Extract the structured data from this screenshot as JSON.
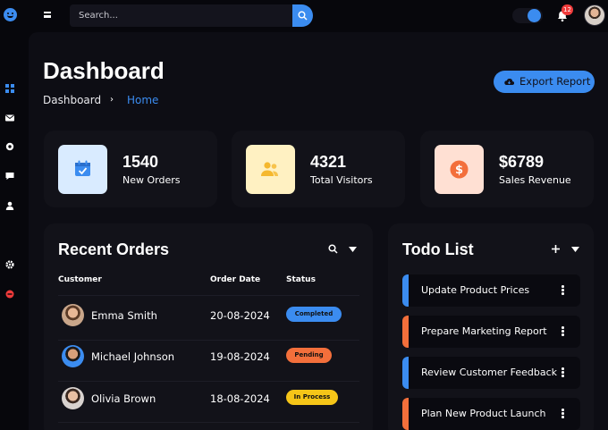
{
  "search": {
    "placeholder": "Search..."
  },
  "notifications": {
    "count": "12"
  },
  "page": {
    "title": "Dashboard",
    "breadcrumb": [
      "Dashboard",
      "Home"
    ],
    "breadcrumb_separator": "›",
    "export_label": "Export Report"
  },
  "stats": [
    {
      "value": "1540",
      "label": "New Orders",
      "icon": "calendar-check-icon",
      "bg": "#d9ebff",
      "fg": "#3b8cf0"
    },
    {
      "value": "4321",
      "label": "Total Visitors",
      "icon": "users-icon",
      "bg": "#fff1c2",
      "fg": "#f5b82e"
    },
    {
      "value": "$6789",
      "label": "Sales Revenue",
      "icon": "dollar-icon",
      "bg": "#ffe0d3",
      "fg": "#f36f3b"
    }
  ],
  "orders": {
    "title": "Recent Orders",
    "columns": [
      "Customer",
      "Order Date",
      "Status"
    ],
    "rows": [
      {
        "customer": "Emma Smith",
        "date": "20-08-2024",
        "status": "Completed",
        "status_color": "#3b8cf0"
      },
      {
        "customer": "Michael Johnson",
        "date": "19-08-2024",
        "status": "Pending",
        "status_color": "#f36f3b"
      },
      {
        "customer": "Olivia Brown",
        "date": "18-08-2024",
        "status": "In Process",
        "status_color": "#f5c518"
      }
    ]
  },
  "todo": {
    "title": "Todo List",
    "items": [
      {
        "text": "Update Product Prices",
        "color": "#3b8cf0"
      },
      {
        "text": "Prepare Marketing Report",
        "color": "#f36f3b"
      },
      {
        "text": "Review Customer Feedback",
        "color": "#3b8cf0"
      },
      {
        "text": "Plan New Product Launch",
        "color": "#f36f3b"
      }
    ]
  },
  "colors": {
    "accent": "#3b8cf0",
    "danger": "#ef3b3b",
    "background": "#07070c",
    "panel": "#121219"
  }
}
